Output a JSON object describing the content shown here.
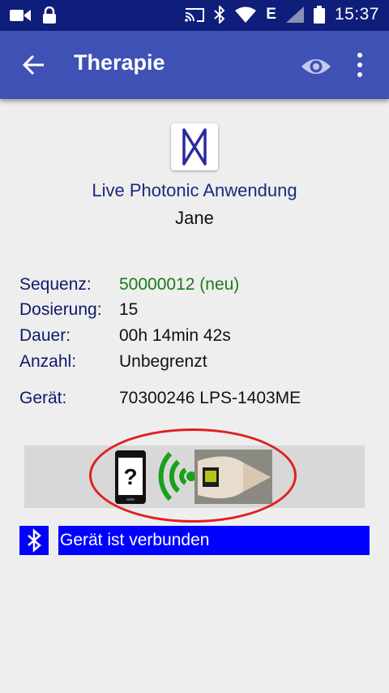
{
  "status_bar": {
    "time": "15:37",
    "network": "E",
    "icons": [
      "video-camera-icon",
      "lock-icon",
      "cast-icon",
      "bluetooth-icon",
      "wifi-icon",
      "signal-icon",
      "battery-icon"
    ]
  },
  "app_bar": {
    "title": "Therapie",
    "icons": [
      "back-arrow-icon",
      "eye-icon",
      "more-vert-icon"
    ]
  },
  "header": {
    "app_name": "Live Photonic Anwendung",
    "user_name": "Jane"
  },
  "info": {
    "sequence_label": "Sequenz:",
    "sequence_value": "50000012 (neu)",
    "dosage_label": "Dosierung:",
    "dosage_value": "15",
    "duration_label": "Dauer:",
    "duration_value": "00h 14min 42s",
    "count_label": "Anzahl:",
    "count_value": "Unbegrenzt",
    "device_label": "Gerät:",
    "device_value": "70300246 LPS-1403ME"
  },
  "device_panel": {
    "phone_symbol": "?"
  },
  "connection": {
    "status_text": "Gerät ist verbunden"
  },
  "colors": {
    "status_bar": "#0e1e7a",
    "app_bar": "#3f51b5",
    "accent_blue": "#0000ff",
    "highlight_circle": "#e02020",
    "sequence_green": "#1b7a1b"
  }
}
